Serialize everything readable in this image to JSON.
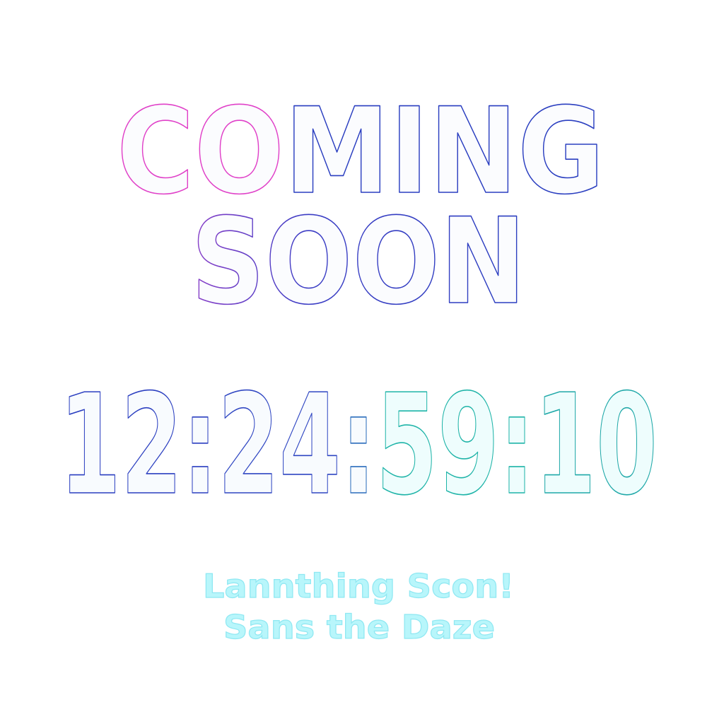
{
  "headline": {
    "line1_highlight": "CO",
    "line1_rest": "MING",
    "line2": "SOON"
  },
  "countdown": {
    "hours": "12",
    "minutes": "24",
    "seconds": "59",
    "frames": "10",
    "separator": ":"
  },
  "tagline": {
    "line1": "Lannthing Scon!",
    "line2": "Sans the Daze"
  },
  "colors": {
    "highlight": "#e040c8",
    "primary": "#2a3ec0",
    "secondary": "#1fb4a8",
    "tagline": "#b8f6fb",
    "background": "#ffffff"
  }
}
